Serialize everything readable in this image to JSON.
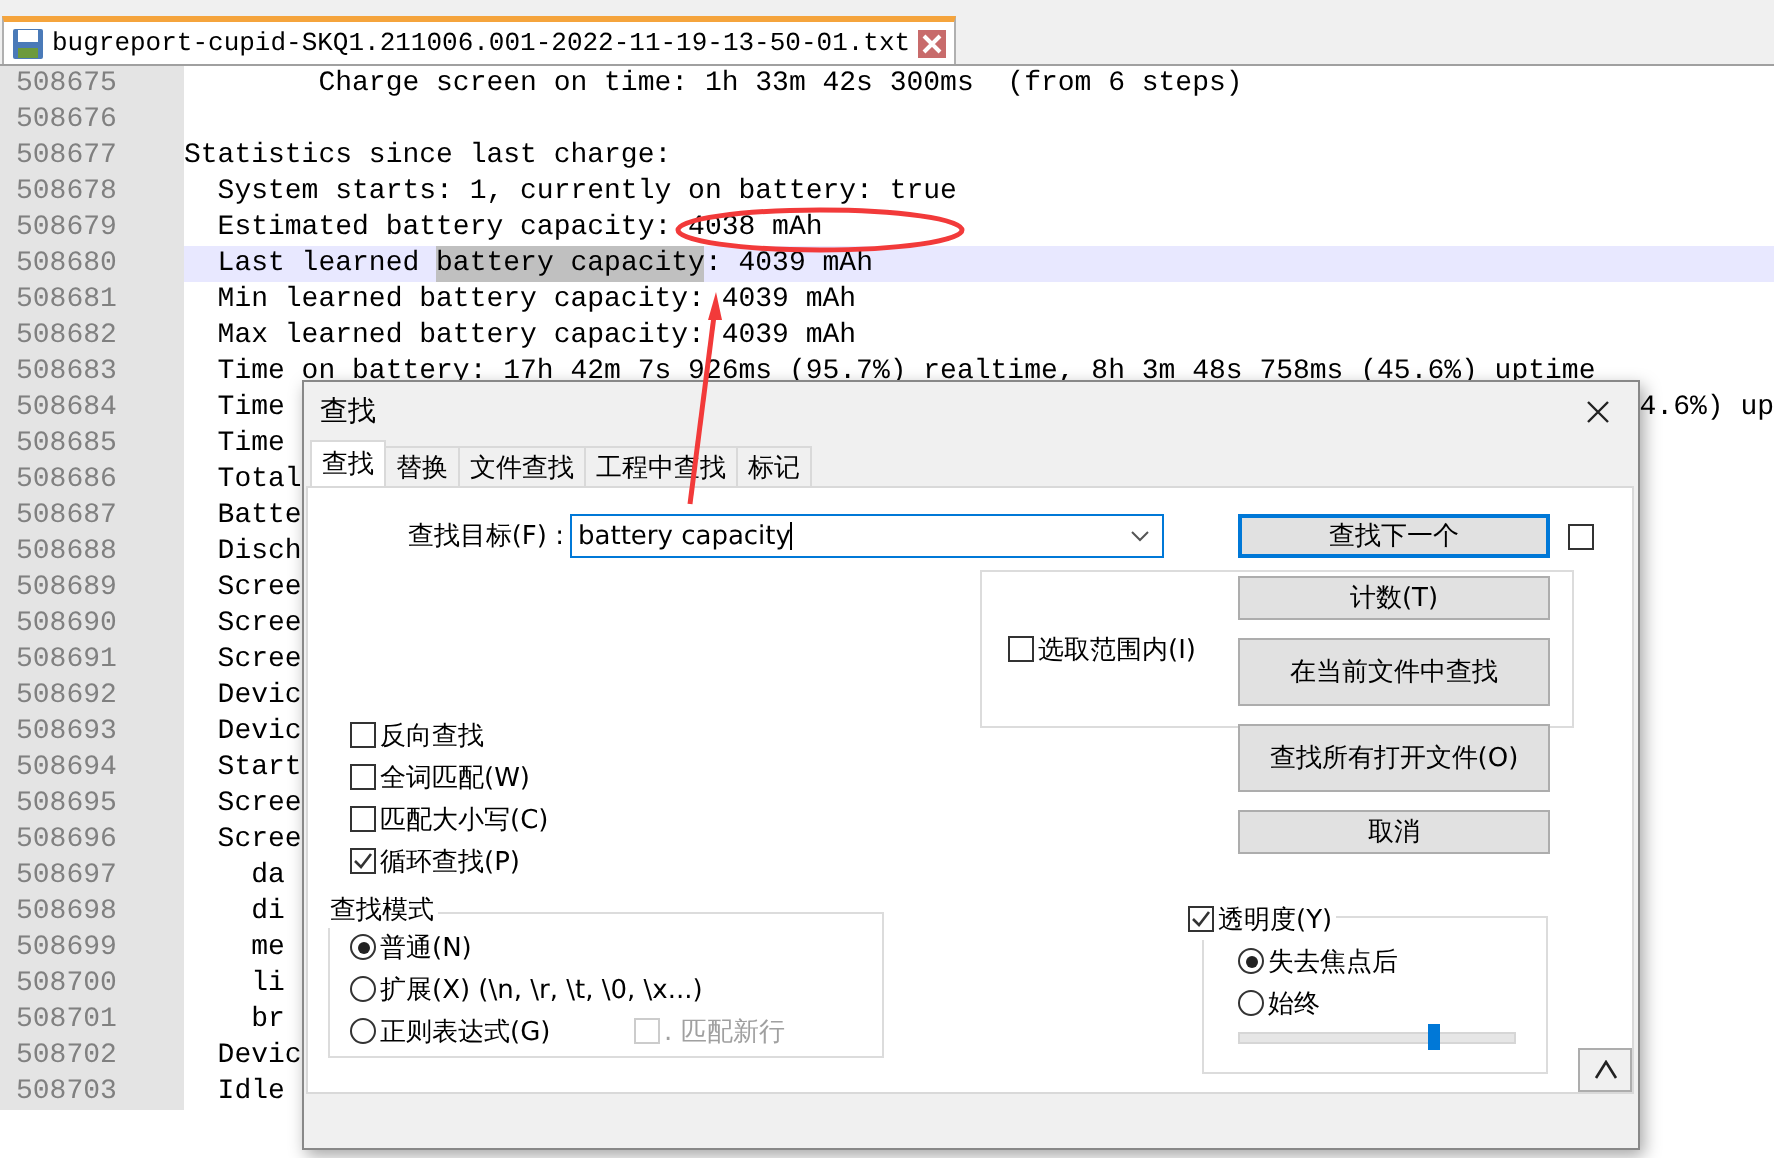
{
  "tab": {
    "title": "bugreport-cupid-SKQ1.211006.001-2022-11-19-13-50-01.txt",
    "selected": true
  },
  "editor": {
    "lines": [
      {
        "number": "508675",
        "text": "        Charge screen on time: 1h 33m 42s 300ms  (from 6 steps)"
      },
      {
        "number": "508676"
      },
      {
        "number": "508677",
        "text": "Statistics since last charge:"
      },
      {
        "number": "508678",
        "text": "  System starts: 1, currently on battery: true"
      },
      {
        "number": "508679",
        "text": "  Estimated battery capacity: 4038 mAh"
      },
      {
        "number": "508680",
        "text": "  Last learned ",
        "match": "battery capacity",
        "after": ": 4039 mAh",
        "current": true
      },
      {
        "number": "508681",
        "text": "  Min learned battery capacity: 4039 mAh"
      },
      {
        "number": "508682",
        "text": "  Max learned battery capacity: 4039 mAh"
      },
      {
        "number": "508683",
        "text": "  Time on battery: 17h 42m 7s 926ms (95.7%) realtime, 8h 3m 48s 758ms (45.6%) uptime"
      },
      {
        "number": "508684",
        "text": "  Time",
        "right": "4.6%) up"
      },
      {
        "number": "508685",
        "text": "  Time"
      },
      {
        "number": "508686",
        "text": "  Total"
      },
      {
        "number": "508687",
        "text": "  Batte"
      },
      {
        "number": "508688",
        "text": "  Disch"
      },
      {
        "number": "508689",
        "text": "  Scree"
      },
      {
        "number": "508690",
        "text": "  Scree"
      },
      {
        "number": "508691",
        "text": "  Scree"
      },
      {
        "number": "508692",
        "text": "  Devic"
      },
      {
        "number": "508693",
        "text": "  Devic"
      },
      {
        "number": "508694",
        "text": "  Start"
      },
      {
        "number": "508695",
        "text": "  Scree"
      },
      {
        "number": "508696",
        "text": "  Scree"
      },
      {
        "number": "508697",
        "text": "    da"
      },
      {
        "number": "508698",
        "text": "    di"
      },
      {
        "number": "508699",
        "text": "    me"
      },
      {
        "number": "508700",
        "text": "    li"
      },
      {
        "number": "508701",
        "text": "    br"
      },
      {
        "number": "508702",
        "text": "  Devic"
      },
      {
        "number": "508703",
        "text": "  Idle"
      }
    ]
  },
  "dialog": {
    "title": "查找",
    "tabs": [
      {
        "label": "查找",
        "selected": true
      },
      {
        "label": "替换",
        "selected": false
      },
      {
        "label": "文件查找",
        "selected": false
      },
      {
        "label": "工程中查找",
        "selected": false
      },
      {
        "label": "标记",
        "selected": false
      }
    ],
    "find_label": "查找目标(F) :",
    "find_value": "battery capacity",
    "side_checkbox": {
      "checked": false
    },
    "in_selection": {
      "label": "选取范围内(I)",
      "checked": false
    },
    "buttons": [
      {
        "label": "查找下一个",
        "default": true
      },
      {
        "label": "计数(T)",
        "default": false
      },
      {
        "label": "在当前文件中查找",
        "default": false
      },
      {
        "label": "查找所有打开文件(O)",
        "default": false
      },
      {
        "label": "取消",
        "default": false
      }
    ],
    "options": [
      {
        "label": "反向查找",
        "checked": false
      },
      {
        "label": "全词匹配(W)",
        "checked": false
      },
      {
        "label": "匹配大小写(C)",
        "checked": false
      },
      {
        "label": "循环查找(P)",
        "checked": true
      }
    ],
    "mode": {
      "title": "查找模式",
      "options": [
        {
          "label": "普通(N)",
          "selected": true
        },
        {
          "label": "扩展(X) (\\n, \\r, \\t, \\0, \\x...)",
          "selected": false
        },
        {
          "label": "正则表达式(G)",
          "selected": false
        }
      ],
      "dot_newline": {
        "label": ". 匹配新行",
        "checked": false,
        "disabled": true
      }
    },
    "transparency": {
      "label": "透明度(Y)",
      "checked": true,
      "options": [
        {
          "label": "失去焦点后",
          "selected": true
        },
        {
          "label": "始终",
          "selected": false
        }
      ],
      "level": 0.71
    }
  }
}
